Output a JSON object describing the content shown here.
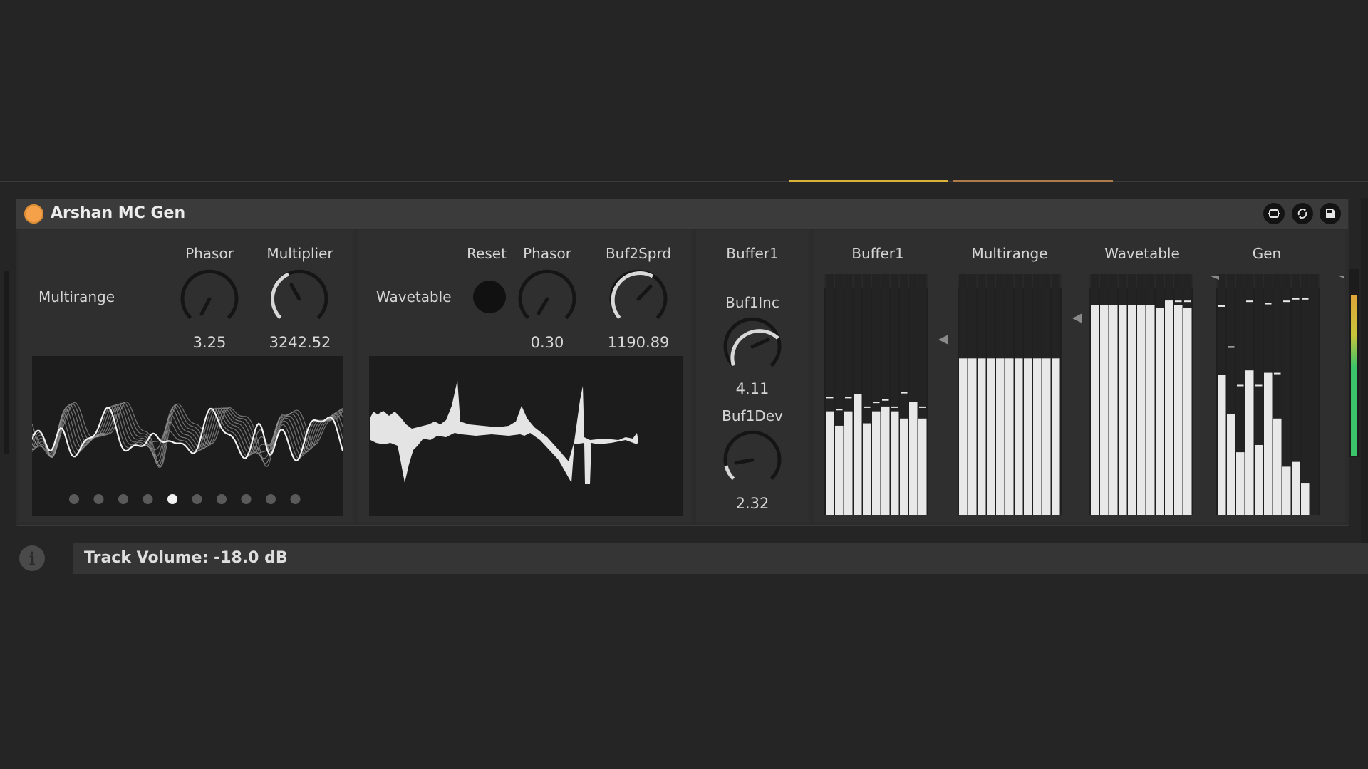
{
  "device": {
    "title": "Arshan MC Gen",
    "power_color": "#f5a14a",
    "header_icons": [
      "expand-icon",
      "hot-swap-icon",
      "save-preset-icon"
    ]
  },
  "multirange": {
    "label": "Multirange",
    "knobs": [
      {
        "label": "Phasor",
        "value": "3.25"
      },
      {
        "label": "Multiplier",
        "value": "3242.52"
      }
    ],
    "pager_dots": 10,
    "active_dot": 5
  },
  "wavetable": {
    "label": "Wavetable",
    "reset_label": "Reset",
    "knobs": [
      {
        "label": "Phasor",
        "value": "0.30"
      },
      {
        "label": "Buf2Sprd",
        "value": "1190.89"
      }
    ]
  },
  "buffer1": {
    "header": "Buffer1",
    "knobs": [
      {
        "label": "Buf1Inc",
        "value": "4.11"
      },
      {
        "label": "Buf1Dev",
        "value": "2.32"
      }
    ]
  },
  "meters": [
    {
      "label": "Buffer1",
      "levels": [
        0.43,
        0.37,
        0.43,
        0.5,
        0.38,
        0.43,
        0.45,
        0.43,
        0.4,
        0.47,
        0.4
      ],
      "peaks": [
        0.49,
        0.44,
        0.49,
        0.5,
        0.45,
        0.47,
        0.48,
        0.45,
        0.51,
        0.47,
        0.45
      ]
    },
    {
      "label": "Multirange",
      "levels": [
        0.65,
        0.65,
        0.65,
        0.65,
        0.65,
        0.65,
        0.65,
        0.65,
        0.65,
        0.65,
        0.65
      ],
      "peaks": []
    },
    {
      "label": "Wavetable",
      "levels": [
        0.87,
        0.87,
        0.87,
        0.87,
        0.87,
        0.87,
        0.87,
        0.86,
        0.89,
        0.87,
        0.86
      ],
      "peaks": [
        null,
        null,
        null,
        null,
        null,
        null,
        null,
        null,
        0.89,
        0.89,
        0.89
      ]
    },
    {
      "label": "Gen",
      "levels": [
        0.58,
        0.42,
        0.26,
        0.6,
        0.29,
        0.59,
        0.4,
        0.2,
        0.22,
        0.13,
        0.0
      ],
      "peaks": [
        0.87,
        0.7,
        0.54,
        0.89,
        0.54,
        0.88,
        0.59,
        0.89,
        0.9,
        0.9,
        0.0
      ]
    }
  ],
  "status": {
    "info_text": "Track Volume: -18.0 dB"
  }
}
